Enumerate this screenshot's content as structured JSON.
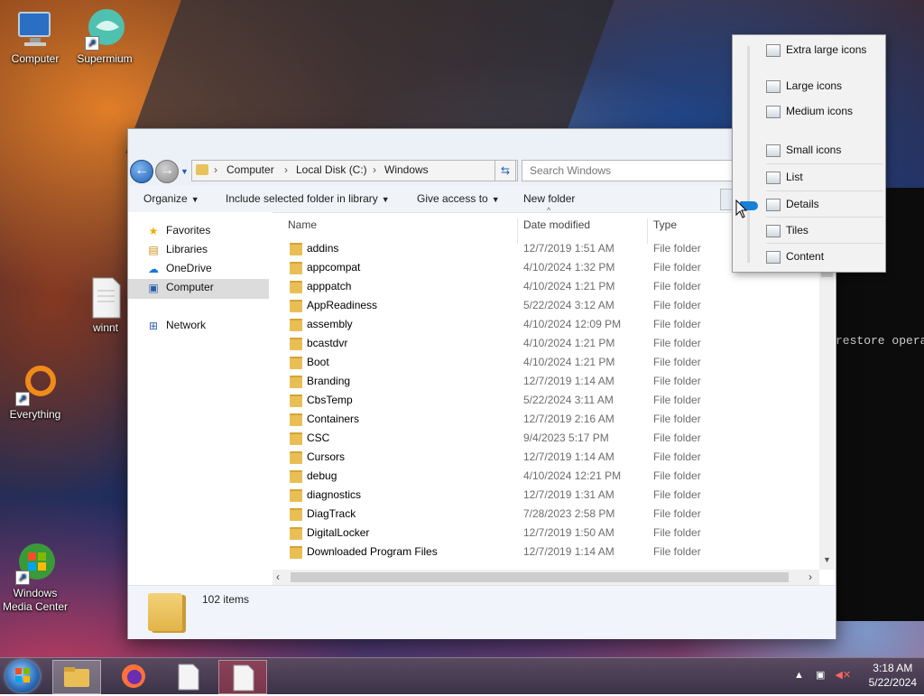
{
  "desktop": {
    "icons": [
      {
        "label": "Computer"
      },
      {
        "label": "Supermium"
      },
      {
        "label": "winnt"
      },
      {
        "label": "Everything"
      },
      {
        "label": "Windows\nMedia Center"
      }
    ],
    "console_text": "restore opera"
  },
  "explorer": {
    "breadcrumb": [
      "Computer",
      "Local Disk (C:)",
      "Windows"
    ],
    "search_placeholder": "Search Windows",
    "toolbar": {
      "organize": "Organize",
      "include": "Include selected folder in library",
      "give_access": "Give access to",
      "new_folder": "New folder"
    },
    "nav": [
      {
        "label": "Favorites",
        "icon": "star-icon"
      },
      {
        "label": "Libraries",
        "icon": "libraries-icon"
      },
      {
        "label": "OneDrive",
        "icon": "cloud-icon"
      },
      {
        "label": "Computer",
        "icon": "computer-icon"
      },
      {
        "label": "Network",
        "icon": "network-icon"
      }
    ],
    "columns": {
      "name": "Name",
      "date": "Date modified",
      "type": "Type"
    },
    "files": [
      {
        "name": "addins",
        "date": "12/7/2019 1:51 AM",
        "type": "File folder"
      },
      {
        "name": "appcompat",
        "date": "4/10/2024 1:32 PM",
        "type": "File folder"
      },
      {
        "name": "apppatch",
        "date": "4/10/2024 1:21 PM",
        "type": "File folder"
      },
      {
        "name": "AppReadiness",
        "date": "5/22/2024 3:12 AM",
        "type": "File folder"
      },
      {
        "name": "assembly",
        "date": "4/10/2024 12:09 PM",
        "type": "File folder"
      },
      {
        "name": "bcastdvr",
        "date": "4/10/2024 1:21 PM",
        "type": "File folder"
      },
      {
        "name": "Boot",
        "date": "4/10/2024 1:21 PM",
        "type": "File folder"
      },
      {
        "name": "Branding",
        "date": "12/7/2019 1:14 AM",
        "type": "File folder"
      },
      {
        "name": "CbsTemp",
        "date": "5/22/2024 3:11 AM",
        "type": "File folder"
      },
      {
        "name": "Containers",
        "date": "12/7/2019 2:16 AM",
        "type": "File folder"
      },
      {
        "name": "CSC",
        "date": "9/4/2023 5:17 PM",
        "type": "File folder"
      },
      {
        "name": "Cursors",
        "date": "12/7/2019 1:14 AM",
        "type": "File folder"
      },
      {
        "name": "debug",
        "date": "4/10/2024 12:21 PM",
        "type": "File folder"
      },
      {
        "name": "diagnostics",
        "date": "12/7/2019 1:31 AM",
        "type": "File folder"
      },
      {
        "name": "DiagTrack",
        "date": "7/28/2023 2:58 PM",
        "type": "File folder"
      },
      {
        "name": "DigitalLocker",
        "date": "12/7/2019 1:50 AM",
        "type": "File folder"
      },
      {
        "name": "Downloaded Program Files",
        "date": "12/7/2019 1:14 AM",
        "type": "File folder"
      }
    ],
    "status_count": "102 items"
  },
  "view_menu": {
    "items": [
      {
        "label": "Extra large icons"
      },
      {
        "label": "Large icons"
      },
      {
        "label": "Medium icons"
      },
      {
        "label": "Small icons"
      },
      {
        "label": "List"
      },
      {
        "label": "Details"
      },
      {
        "label": "Tiles"
      },
      {
        "label": "Content"
      }
    ],
    "selected": "Details"
  },
  "taskbar": {
    "time": "3:18 AM",
    "date": "5/22/2024"
  }
}
